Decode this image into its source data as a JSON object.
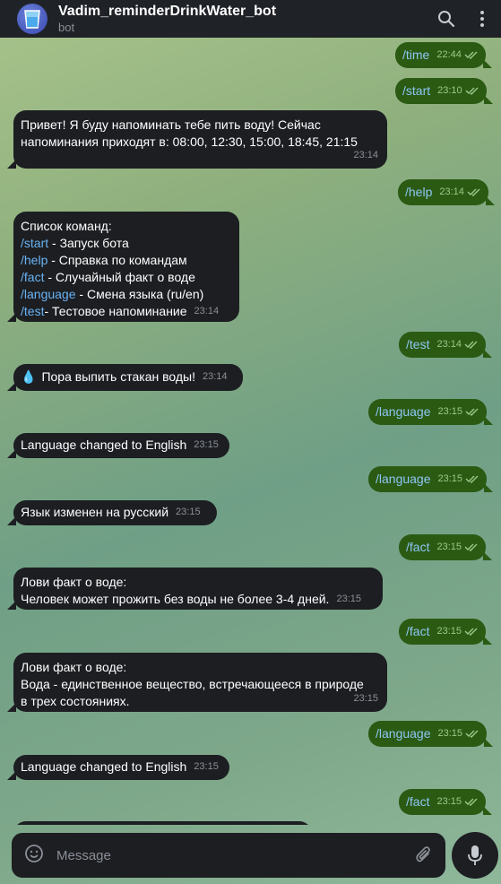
{
  "header": {
    "title": "Vadim_reminderDrinkWater_bot",
    "subtitle": "bot"
  },
  "messages": {
    "m1": {
      "text": "/time",
      "time": "22:44"
    },
    "m2": {
      "text": "/start",
      "time": "23:10"
    },
    "m3": {
      "line1": "Привет! Я буду напоминать тебе пить воду! Сейчас",
      "line2": "напоминания приходят в: 08:00, 12:30, 15:00, 18:45, 21:15",
      "time": "23:14"
    },
    "m4": {
      "text": "/help",
      "time": "23:14"
    },
    "m5": {
      "heading": "Список команд:",
      "items": [
        {
          "cmd": "/start",
          "desc": " - Запуск бота"
        },
        {
          "cmd": "/help",
          "desc": " - Справка по командам"
        },
        {
          "cmd": "/fact",
          "desc": " - Случайный факт о воде"
        },
        {
          "cmd": "/language",
          "desc": " - Смена языка (ru/en)"
        },
        {
          "cmd": "/test",
          "desc": " - Тестовое напоминание"
        }
      ],
      "time": "23:14"
    },
    "m6": {
      "text": "/test",
      "time": "23:14"
    },
    "m7": {
      "emoji": "💧",
      "text": "Пора выпить стакан воды!",
      "time": "23:14"
    },
    "m8": {
      "text": "/language",
      "time": "23:15"
    },
    "m9": {
      "text": "Language changed to English",
      "time": "23:15"
    },
    "m10": {
      "text": "/language",
      "time": "23:15"
    },
    "m11": {
      "text": "Язык изменен на русский",
      "time": "23:15"
    },
    "m12": {
      "text": "/fact",
      "time": "23:15"
    },
    "m13": {
      "line1": "Лови факт о воде:",
      "line2": "Человек может прожить без воды не более 3-4 дней.",
      "time": "23:15"
    },
    "m14": {
      "text": "/fact",
      "time": "23:15"
    },
    "m15": {
      "line1": "Лови факт о воде:",
      "line2": "Вода - единственное вещество, встречающееся в природе",
      "line3": "в трех состояниях.",
      "time": "23:15"
    },
    "m16": {
      "text": "/language",
      "time": "23:15"
    },
    "m17": {
      "text": "Language changed to English",
      "time": "23:15"
    },
    "m18": {
      "text": "/fact",
      "time": "23:15"
    }
  },
  "composer": {
    "placeholder": "Message"
  },
  "icons": {
    "search": "search-icon",
    "menu": "more-vertical-icon",
    "emoji": "emoji-icon",
    "attach": "paperclip-icon",
    "mic": "microphone-icon",
    "read": "double-check-icon"
  },
  "colors": {
    "header_bg": "#1f2227",
    "incoming_bg": "#1c1e22",
    "outgoing_bg": "#2b5a13",
    "link": "#6ab3f3"
  }
}
